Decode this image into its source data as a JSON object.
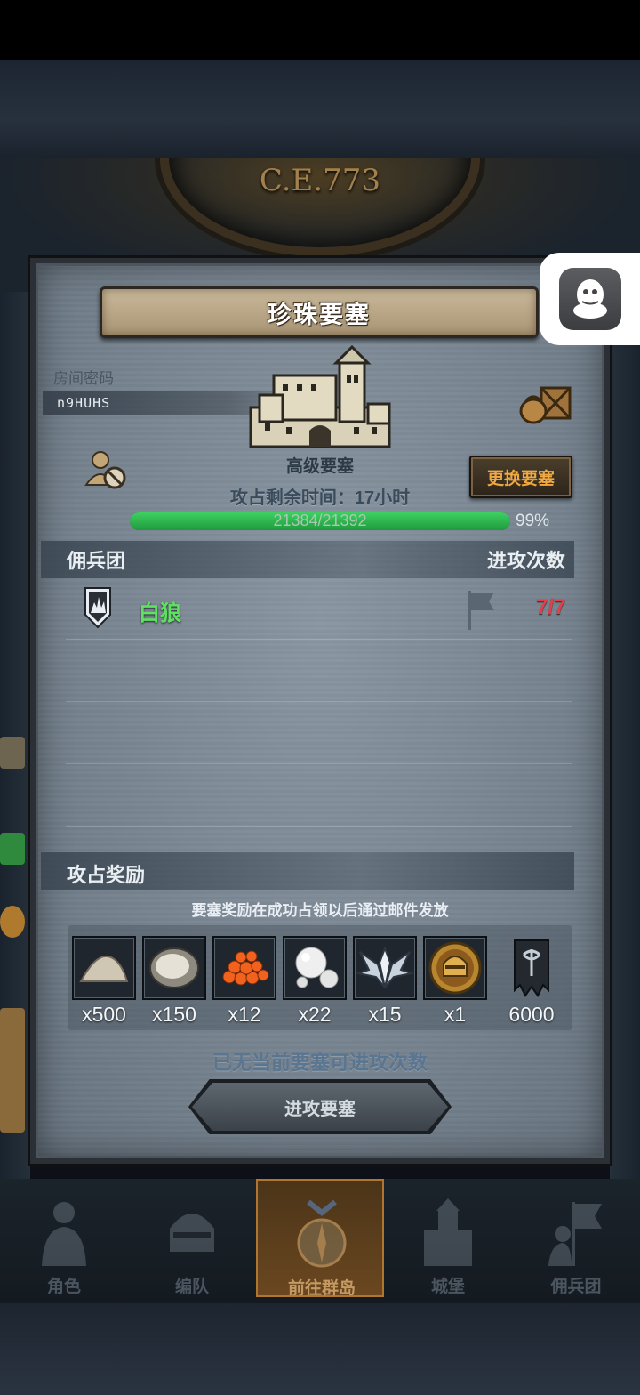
{
  "header": {
    "era": "C.E.773"
  },
  "dialog": {
    "title": "珍珠要塞",
    "room_password_label": "房间密码",
    "room_code": "n9HUHS",
    "fortress_type": "高级要塞",
    "remaining_time": "攻占剩余时间：17小时",
    "change_button": "更换要塞",
    "progress": {
      "text": "21384/21392",
      "current": 21384,
      "max": 21392,
      "percent_label": "99%"
    },
    "mercenary_header": "佣兵团",
    "attack_count_header": "进攻次数",
    "mercenaries": [
      {
        "name": "白狼",
        "attacks": "7/7"
      }
    ],
    "reward_header": "攻占奖励",
    "reward_note": "要塞奖励在成功占领以后通过邮件发放",
    "rewards": [
      {
        "icon": "salt-pile-icon",
        "qty": "x500"
      },
      {
        "icon": "oyster-icon",
        "qty": "x150"
      },
      {
        "icon": "fish-roe-icon",
        "qty": "x12"
      },
      {
        "icon": "pearl-icon",
        "qty": "x22"
      },
      {
        "icon": "winged-emblem-icon",
        "qty": "x15"
      },
      {
        "icon": "knight-helmet-coin-icon",
        "qty": "x1"
      },
      {
        "icon": "banner-icon",
        "qty": "6000"
      }
    ],
    "no_attacks_notice": "已无当前要塞可进攻次数",
    "attack_button": "进攻要塞"
  },
  "nav": [
    {
      "label": "角色",
      "icon": "knight-icon"
    },
    {
      "label": "编队",
      "icon": "helmet-icon"
    },
    {
      "label": "前往群岛",
      "icon": "compass-icon",
      "active": true
    },
    {
      "label": "城堡",
      "icon": "castle-icon"
    },
    {
      "label": "佣兵团",
      "icon": "mercenary-icon"
    }
  ],
  "colors": {
    "accent_orange": "#f0a840",
    "progress_green": "#3fd062",
    "merc_name": "#5fe25f",
    "attack_count": "#e0404a"
  }
}
